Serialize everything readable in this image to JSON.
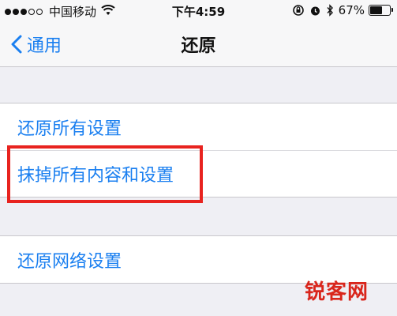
{
  "status_bar": {
    "carrier": "中国移动",
    "time": "下午4:59",
    "battery_percent": "67%",
    "battery_level": 0.67,
    "icons": [
      "signal-dots-icon",
      "wifi-icon",
      "orientation-lock-icon",
      "alarm-icon",
      "bluetooth-icon",
      "battery-icon"
    ]
  },
  "nav": {
    "back_label": "通用",
    "title": "还原"
  },
  "groups": [
    {
      "items": [
        "还原所有设置",
        "抹掉所有内容和设置"
      ]
    },
    {
      "items": [
        "还原网络设置"
      ]
    }
  ],
  "annotation": {
    "color": "#e8231f"
  },
  "watermark": {
    "text": "锐客网"
  },
  "colors": {
    "accent": "#1a7ff0",
    "background": "#efeff4"
  }
}
